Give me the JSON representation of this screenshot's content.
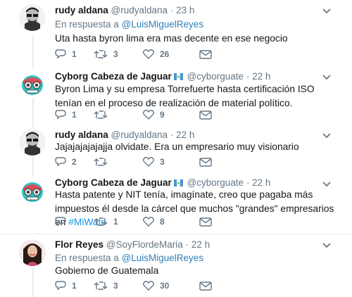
{
  "tweets": [
    {
      "name": "rudy aldana",
      "handle": "@rudyaldana",
      "sep": "·",
      "time": "23 h",
      "reply_prefix": "En respuesta a ",
      "reply_to": "@LuisMiguelReyes",
      "text": "Uta hasta byron lima era mas decente en ese negocio",
      "replies": "1",
      "retweets": "3",
      "likes": "26"
    },
    {
      "name": "Cyborg Cabeza de Jaguar",
      "handle": "@cyborguate",
      "sep": "·",
      "time": "22 h",
      "text": "Byron Lima y su empresa Torrefuerte hasta certificación ISO tenían en el proceso de realización de material político.",
      "replies": "1",
      "retweets": "",
      "likes": "9"
    },
    {
      "name": "rudy aldana",
      "handle": "@rudyaldana",
      "sep": "·",
      "time": "22 h",
      "text": "Jajajajajajajja olvidate.  Era un empresario muy visionario",
      "replies": "2",
      "retweets": "",
      "likes": "3"
    },
    {
      "name": "Cyborg Cabeza de Jaguar",
      "handle": "@cyborguate",
      "sep": "·",
      "time": "22 h",
      "text_before": "Hasta patente y NIT tenía, imagínate, creo que pagaba más impuestos él desde la cárcel que muchos \"grandes\" empresarios en ",
      "hashtag": "#MiWate",
      "replies": "",
      "retweets": "1",
      "likes": "8"
    },
    {
      "name": "Flor Reyes",
      "handle": "@SoyFlordeMaria",
      "sep": "·",
      "time": "22 h",
      "reply_prefix": "En respuesta a ",
      "reply_to": "@LuisMiguelReyes",
      "text": "Gobierno de Guatemala",
      "replies": "1",
      "retweets": "3",
      "likes": "30"
    }
  ],
  "colors": {
    "text": "#14171a",
    "secondary": "#657786",
    "link": "#1b95e0",
    "thread_line": "#e6ecf0"
  },
  "icons": {
    "reply": "reply-icon",
    "retweet": "retweet-icon",
    "like": "heart-icon",
    "dm": "envelope-icon",
    "more": "chevron-down-icon",
    "flag": "guatemala-flag-icon"
  }
}
